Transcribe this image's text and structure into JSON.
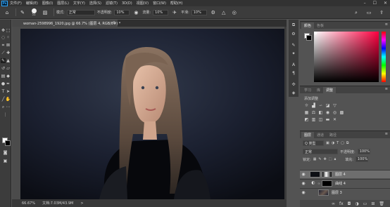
{
  "menubar": {
    "logo": "Ps",
    "items": [
      "文件(F)",
      "编辑(E)",
      "图像(I)",
      "图层(L)",
      "文字(Y)",
      "选择(S)",
      "滤镜(T)",
      "3D(D)",
      "视图(V)",
      "窗口(W)",
      "帮助(H)"
    ],
    "window_controls": [
      "–",
      "☐",
      "✕"
    ]
  },
  "options": {
    "brush_size": "51",
    "mode_label": "模式:",
    "mode_value": "正常",
    "opacity_label": "不透明度:",
    "opacity_value": "10%",
    "flow_label": "流量:",
    "flow_value": "10%",
    "smoothing_label": "平滑:",
    "smoothing_value": "10%"
  },
  "document": {
    "tab_title": "woman-2598996_1920.jpg @ 66.7% (图层 4, RGB/8#) *",
    "close": "×",
    "zoom": "66.67%",
    "doc_info": "文档:7.03M/43.9M",
    "nav": ">"
  },
  "color_panel": {
    "tabs": [
      "颜色",
      "色板"
    ],
    "fg_color": "#ffffff",
    "bg_color": "#000000",
    "field_hue": "#ff0040"
  },
  "adjust_panel": {
    "tabs": [
      "学习",
      "库",
      "调整"
    ],
    "title": "添加调整"
  },
  "layers_panel": {
    "tabs": [
      "图层",
      "通道",
      "路径"
    ],
    "filter_label": "Q 类型",
    "blend_mode": "正常",
    "opacity_label": "不透明度:",
    "opacity_value": "100%",
    "lock_label": "锁定:",
    "fill_label": "填充:",
    "fill_value": "100%",
    "layers": [
      {
        "name": "图层 4",
        "selected": true
      },
      {
        "name": "曲线 4",
        "selected": false
      },
      {
        "name": "图层 3",
        "selected": false
      }
    ]
  }
}
